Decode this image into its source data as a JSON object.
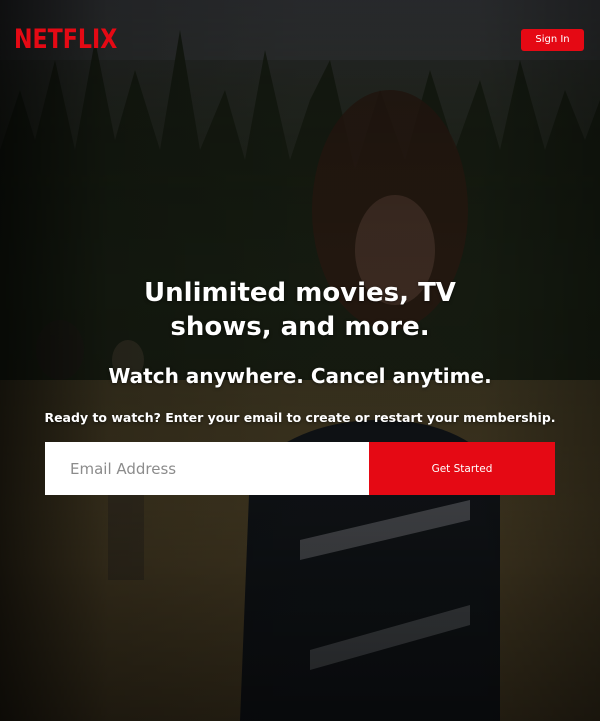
{
  "header": {
    "logo_text": "NETFLIX",
    "signin_label": "Sign In"
  },
  "hero": {
    "headline_line1": "Unlimited movies, TV",
    "headline_line2": "shows, and more.",
    "subheadline": "Watch anywhere. Cancel anytime.",
    "cta_text": "Ready to watch? Enter your email to create or restart your membership."
  },
  "form": {
    "email_placeholder": "Email Address",
    "get_started_label": "Get Started"
  },
  "colors": {
    "brand_red": "#e50914",
    "text_white": "#ffffff"
  }
}
